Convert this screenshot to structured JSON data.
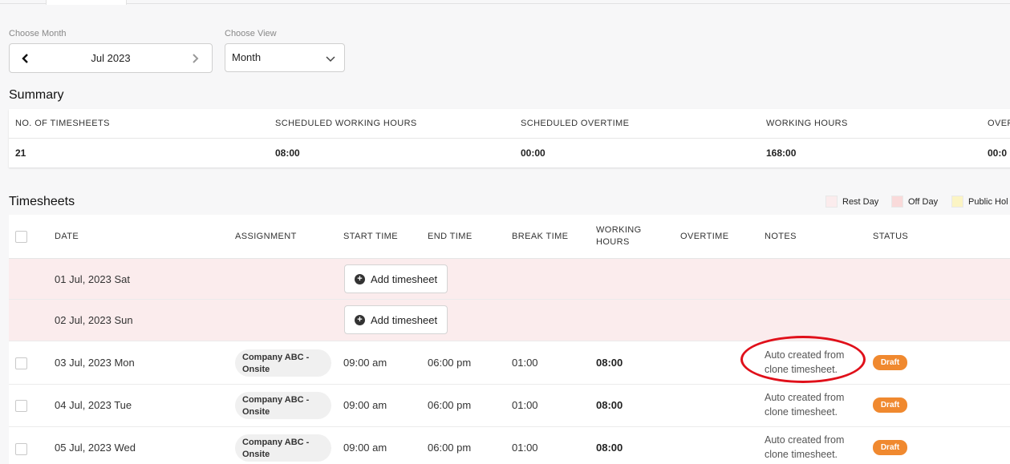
{
  "filters": {
    "month_label": "Choose Month",
    "month_value": "Jul 2023",
    "view_label": "Choose View",
    "view_value": "Month"
  },
  "summary": {
    "title": "Summary",
    "columns": [
      {
        "label": "NO. OF TIMESHEETS",
        "value": "21"
      },
      {
        "label": "SCHEDULED WORKING HOURS",
        "value": "08:00"
      },
      {
        "label": "SCHEDULED OVERTIME",
        "value": "00:00"
      },
      {
        "label": "WORKING HOURS",
        "value": "168:00"
      },
      {
        "label": "OVER",
        "value": "00:0"
      }
    ]
  },
  "timesheets": {
    "title": "Timesheets",
    "legend": [
      {
        "label": "Rest Day",
        "color": "#fbeced"
      },
      {
        "label": "Off Day",
        "color": "#f9dada"
      },
      {
        "label": "Public Hol",
        "color": "#fbf4c4"
      }
    ],
    "headers": {
      "date": "DATE",
      "assignment": "ASSIGNMENT",
      "start": "START TIME",
      "end": "END TIME",
      "break": "BREAK TIME",
      "working_1": "WORKING",
      "working_2": "HOURS",
      "overtime": "OVERTIME",
      "notes": "NOTES",
      "status": "STATUS"
    },
    "add_label": "Add timesheet",
    "rest_rows": [
      {
        "date": "01 Jul, 2023 Sat"
      },
      {
        "date": "02 Jul, 2023 Sun"
      }
    ],
    "rows": [
      {
        "date": "03 Jul, 2023 Mon",
        "assign_1": "Company ABC -",
        "assign_2": "Onsite",
        "start": "09:00 am",
        "end": "06:00 pm",
        "break": "01:00",
        "working": "08:00",
        "notes_1": "Auto created from",
        "notes_2": "clone timesheet.",
        "status": "Draft"
      },
      {
        "date": "04 Jul, 2023 Tue",
        "assign_1": "Company ABC -",
        "assign_2": "Onsite",
        "start": "09:00 am",
        "end": "06:00 pm",
        "break": "01:00",
        "working": "08:00",
        "notes_1": "Auto created from",
        "notes_2": "clone timesheet.",
        "status": "Draft"
      },
      {
        "date": "05 Jul, 2023 Wed",
        "assign_1": "Company ABC -",
        "assign_2": "Onsite",
        "start": "09:00 am",
        "end": "06:00 pm",
        "break": "01:00",
        "working": "08:00",
        "notes_1": "Auto created from",
        "notes_2": "clone timesheet.",
        "status": "Draft"
      }
    ],
    "status_color": "#f0892f",
    "annotation_color": "#e0101a"
  }
}
